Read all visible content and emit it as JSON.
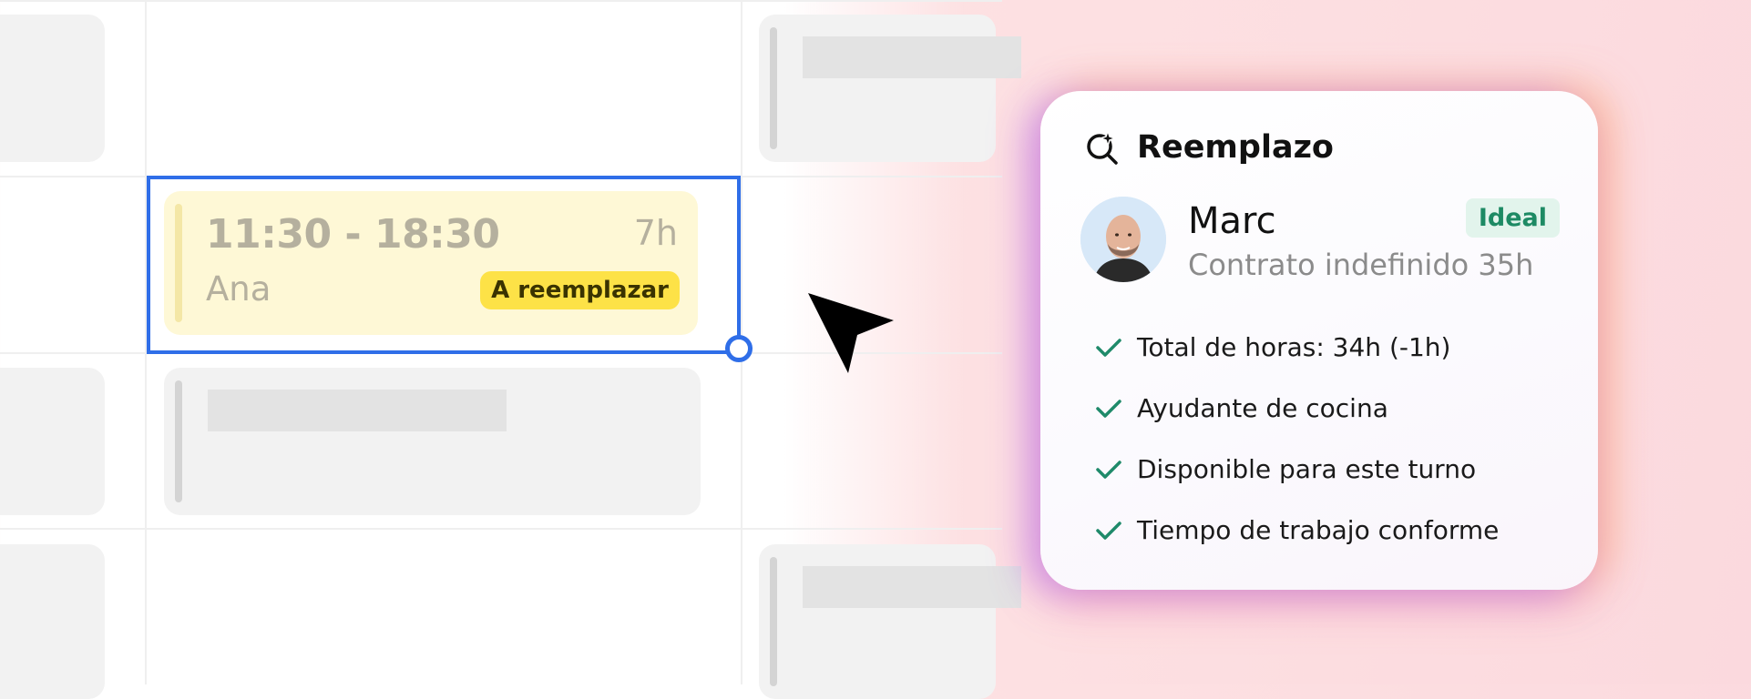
{
  "shift": {
    "time": "11:30 - 18:30",
    "duration": "7h",
    "employee": "Ana",
    "badge": "A reemplazar"
  },
  "replacement_card": {
    "title": "Reemplazo",
    "title_icon": "search-sparkle-icon",
    "candidate": {
      "name": "Marc",
      "contract": "Contrato indefinido 35h",
      "badge": "Ideal"
    },
    "checks": [
      {
        "icon": "check-icon",
        "label": "Total de horas: 34h (-1h)"
      },
      {
        "icon": "check-icon",
        "label": "Ayudante de cocina"
      },
      {
        "icon": "check-icon",
        "label": "Disponible para este turno"
      },
      {
        "icon": "check-icon",
        "label": "Tiempo de trabajo conforme"
      }
    ]
  },
  "colors": {
    "selection": "#2f6ee8",
    "shift_bg": "#fef8d6",
    "badge_yellow": "#fde247",
    "ideal_green": "#1d8a64",
    "check_green": "#1f8a6a"
  }
}
